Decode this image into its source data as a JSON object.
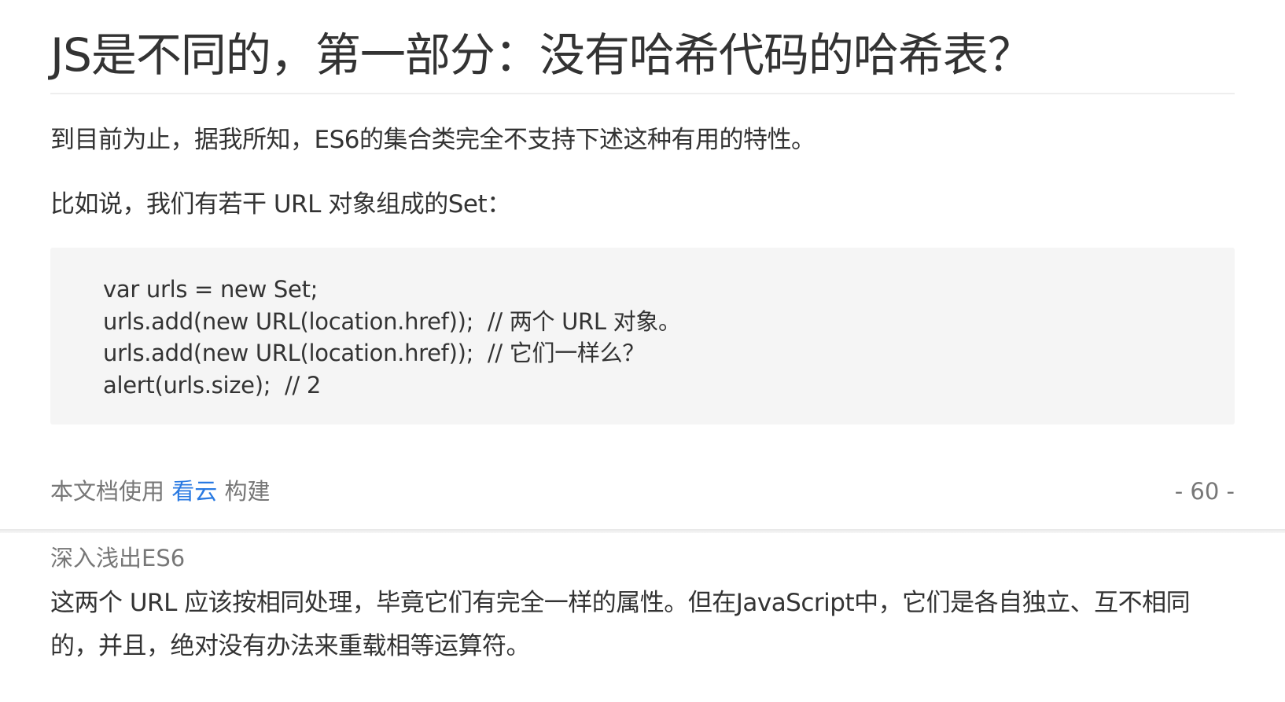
{
  "page": {
    "title": "JS是不同的，第一部分：没有哈希代码的哈希表？",
    "paragraphs": [
      "到目前为止，据我所知，ES6的集合类完全不支持下述这种有用的特性。",
      "比如说，我们有若干 URL 对象组成的Set："
    ],
    "code_lines": [
      "var urls = new Set;",
      "urls.add(new URL(location.href));  // 两个 URL 对象。",
      "urls.add(new URL(location.href));  // 它们一样么？",
      "alert(urls.size);  // 2"
    ],
    "footer": {
      "prefix": "本文档使用 ",
      "link_text": "看云",
      "suffix": " 构建",
      "page_number": "- 60 -"
    }
  },
  "next_page": {
    "running_header": "深入浅出ES6",
    "paragraph": "这两个 URL 应该按相同处理，毕竟它们有完全一样的属性。但在JavaScript中，它们是各自独立、互不相同的，并且，绝对没有办法来重载相等运算符。"
  },
  "colors": {
    "text": "#333333",
    "muted": "#777777",
    "link": "#2a7ae2",
    "code_background": "#f5f5f5"
  }
}
